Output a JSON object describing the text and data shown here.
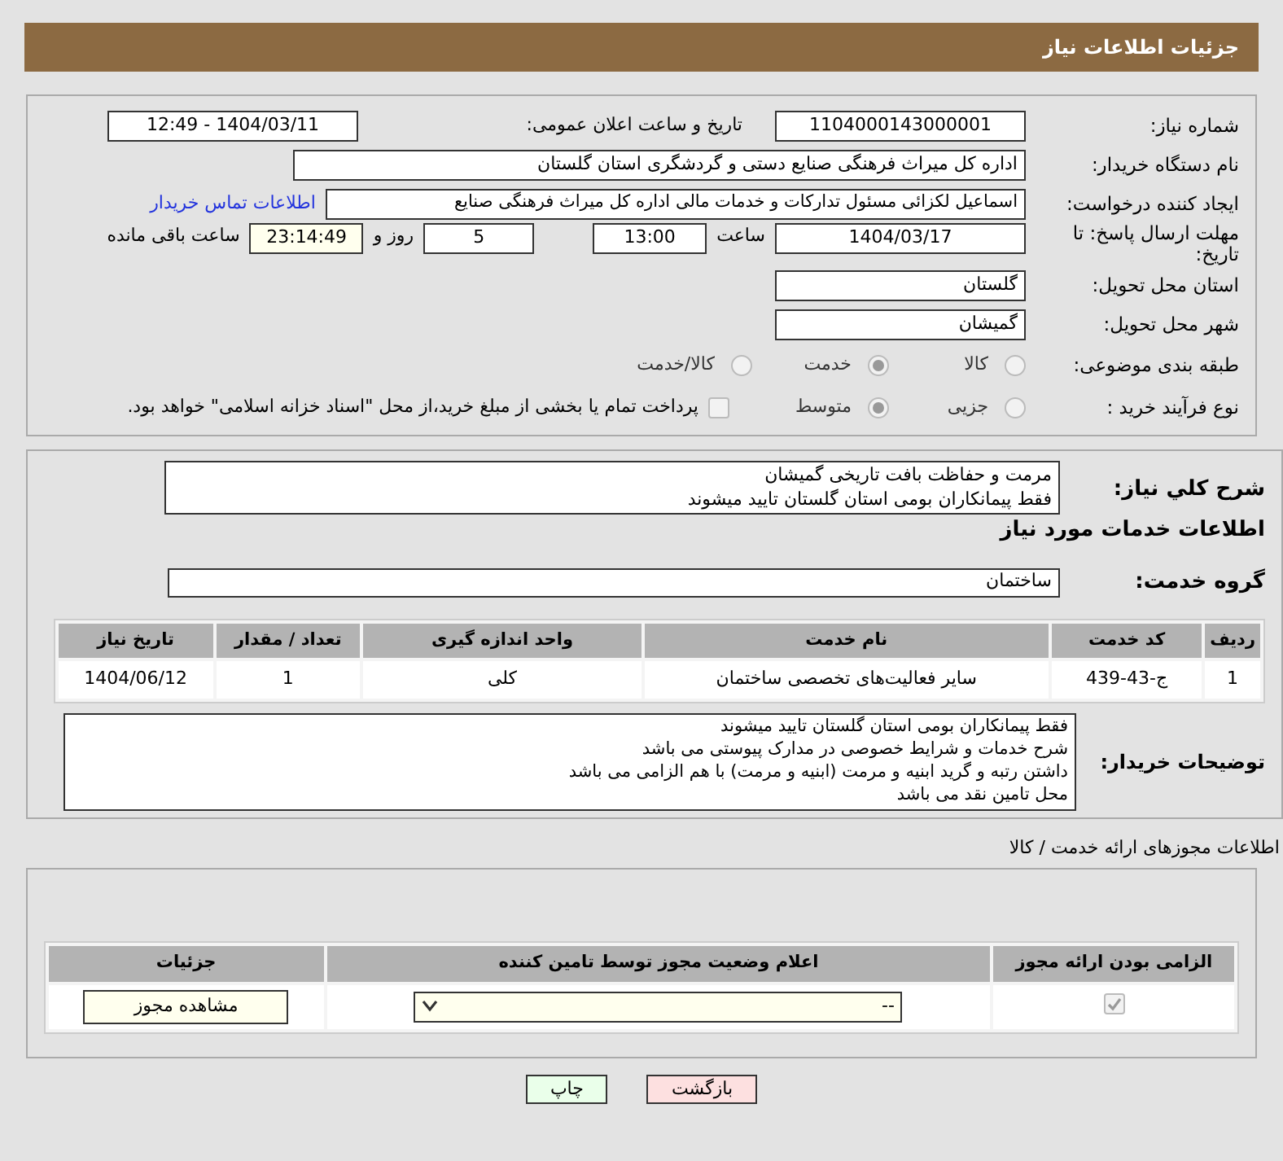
{
  "header": {
    "title": "جزئیات اطلاعات نیاز"
  },
  "details": {
    "need_number": {
      "label": "شماره نیاز:",
      "value": "1104000143000001"
    },
    "announce": {
      "label": "تاریخ و ساعت اعلان عمومی:",
      "value": "1404/03/11 - 12:49"
    },
    "buyer": {
      "label": "نام دستگاه خریدار:",
      "value": "اداره کل میراث فرهنگی  صنایع دستی و گردشگری استان گلستان"
    },
    "creator": {
      "label": "ایجاد کننده درخواست:",
      "value": "اسماعیل لکزائی مسئول تداركات و خدمات مالی اداره کل میراث فرهنگی  صنایع",
      "link": "اطلاعات تماس خریدار"
    },
    "deadline": {
      "label": "مهلت ارسال پاسخ: تا تاریخ:",
      "date": "1404/03/17",
      "time_label": "ساعت",
      "time": "13:00",
      "days": "5",
      "days_label": "روز و",
      "remaining": "23:14:49",
      "remaining_label": "ساعت باقی مانده"
    },
    "province": {
      "label": "استان محل تحویل:",
      "value": "گلستان"
    },
    "city": {
      "label": "شهر محل تحویل:",
      "value": "گمیشان"
    },
    "category": {
      "label": "طبقه بندی موضوعی:",
      "options": [
        {
          "label": "کالا",
          "selected": false
        },
        {
          "label": "خدمت",
          "selected": true
        },
        {
          "label": "کالا/خدمت",
          "selected": false
        }
      ]
    },
    "process": {
      "label": "نوع فرآیند خرید :",
      "options": [
        {
          "label": "جزیی",
          "selected": false
        },
        {
          "label": "متوسط",
          "selected": true
        }
      ],
      "payment": {
        "label": "پرداخت تمام یا بخشی از مبلغ خرید،از محل \"اسناد خزانه اسلامی\" خواهد بود.",
        "checked": false
      }
    }
  },
  "summary": {
    "label": "شرح کلي نياز:",
    "lines": [
      "مرمت و حفاظت بافت تاریخی گمیشان",
      "فقط پیمانکاران بومی استان گلستان تایید میشوند"
    ]
  },
  "services": {
    "title": "اطلاعات خدمات مورد نیاز",
    "group_label": "گروه خدمت:",
    "group": "ساختمان",
    "table": {
      "columns": [
        "ردیف",
        "کد خدمت",
        "نام خدمت",
        "واحد اندازه گیری",
        "تعداد / مقدار",
        "تاریخ نیاز"
      ],
      "rows": [
        [
          "1",
          "ج-43-439",
          "سایر فعالیت‌های تخصصی ساختمان",
          "کلی",
          "1",
          "1404/06/12"
        ]
      ]
    }
  },
  "notes": {
    "label": "توضیحات خریدار:",
    "lines": [
      "فقط پیمانکاران بومی استان گلستان تایید میشوند",
      "شرح خدمات و شرایط خصوصی در مدارک پیوستی می باشد",
      "داشتن رتبه و گرید ابنیه و مرمت (ابنیه و مرمت) با هم الزامی می باشد",
      "محل تامین نقد می باشد"
    ]
  },
  "permits": {
    "title": "اطلاعات مجوزهای ارائه خدمت / کالا",
    "columns": [
      "الزامی بودن ارائه مجوز",
      "اعلام وضعیت مجوز توسط تامین کننده",
      "جزئیات"
    ],
    "rows": [
      {
        "required": true,
        "status": "--",
        "button": "مشاهده مجوز"
      }
    ]
  },
  "buttons": {
    "back": "بازگشت",
    "print": "چاپ"
  }
}
